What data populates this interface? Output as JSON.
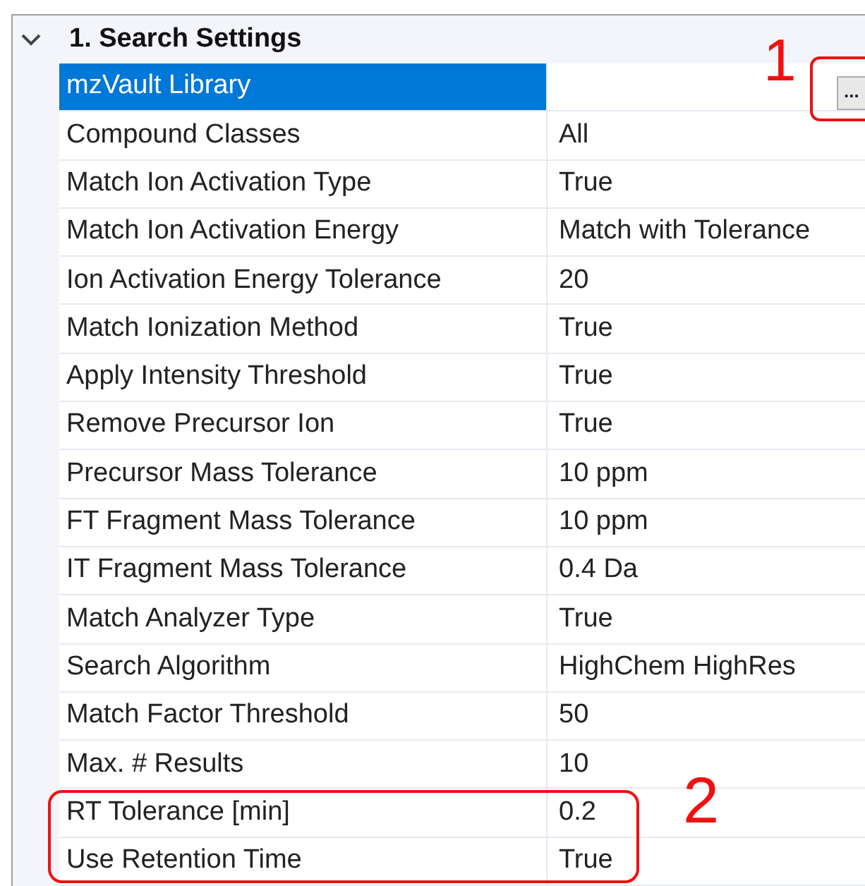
{
  "section": {
    "title": "1. Search Settings",
    "expanded": true
  },
  "rows": [
    {
      "name": "mzVault Library",
      "value": "",
      "selected": true,
      "browse_button": "..."
    },
    {
      "name": "Compound Classes",
      "value": "All",
      "selected": false
    },
    {
      "name": "Match Ion Activation Type",
      "value": "True",
      "selected": false
    },
    {
      "name": "Match Ion Activation Energy",
      "value": "Match with Tolerance",
      "selected": false
    },
    {
      "name": "Ion Activation Energy Tolerance",
      "value": "20",
      "selected": false
    },
    {
      "name": "Match Ionization Method",
      "value": "True",
      "selected": false
    },
    {
      "name": "Apply Intensity Threshold",
      "value": "True",
      "selected": false
    },
    {
      "name": "Remove Precursor Ion",
      "value": "True",
      "selected": false
    },
    {
      "name": "Precursor Mass Tolerance",
      "value": "10 ppm",
      "selected": false
    },
    {
      "name": "FT Fragment Mass Tolerance",
      "value": "10 ppm",
      "selected": false
    },
    {
      "name": "IT Fragment Mass Tolerance",
      "value": "0.4 Da",
      "selected": false
    },
    {
      "name": "Match Analyzer Type",
      "value": "True",
      "selected": false
    },
    {
      "name": "Search Algorithm",
      "value": "HighChem HighRes",
      "selected": false
    },
    {
      "name": "Match Factor Threshold",
      "value": "50",
      "selected": false
    },
    {
      "name": "Max. # Results",
      "value": "10",
      "selected": false
    },
    {
      "name": "RT Tolerance [min]",
      "value": "0.2",
      "selected": false
    },
    {
      "name": "Use Retention Time",
      "value": "True",
      "selected": false
    }
  ],
  "callouts": [
    {
      "label": "1"
    },
    {
      "label": "2"
    }
  ]
}
